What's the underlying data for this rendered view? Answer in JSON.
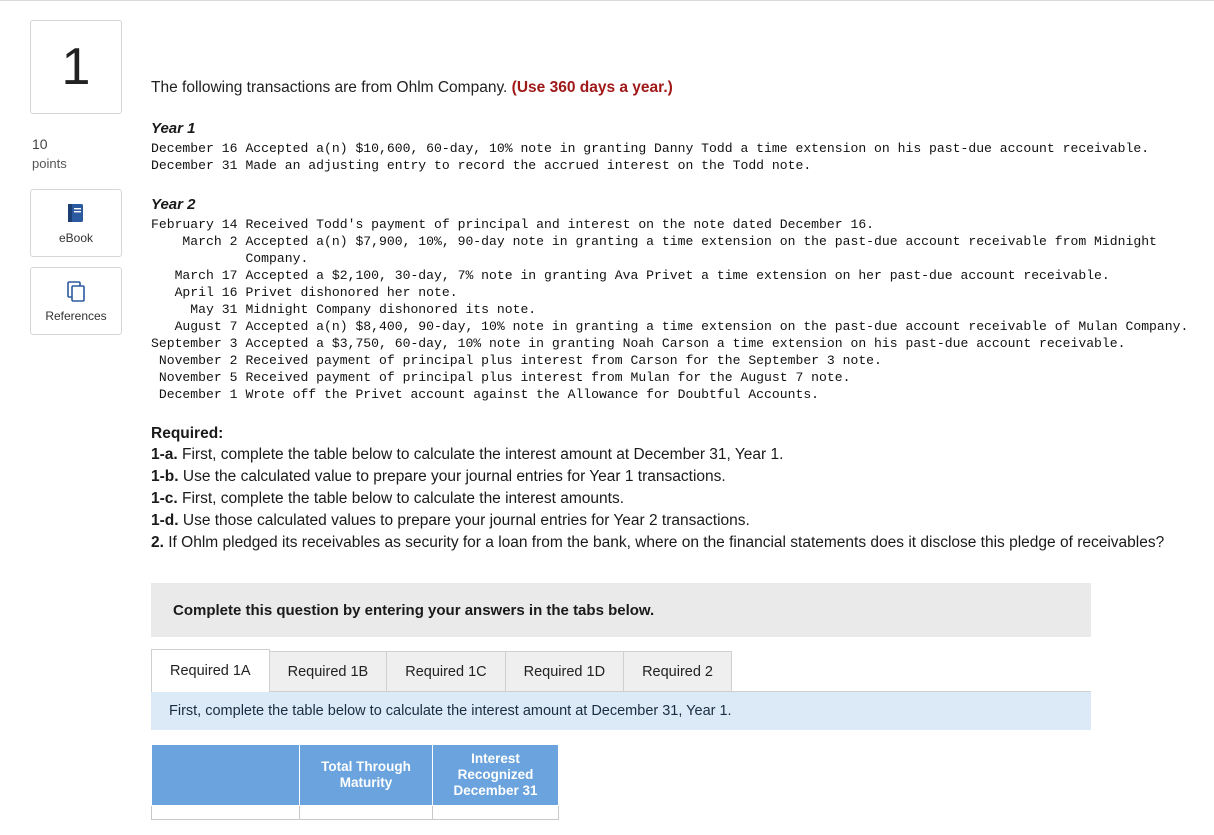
{
  "question": {
    "number": "1",
    "points_value": "10",
    "points_label": "points"
  },
  "rail_buttons": [
    {
      "name": "ebook",
      "label": "eBook",
      "icon": "book-icon"
    },
    {
      "name": "references",
      "label": "References",
      "icon": "copy-icon"
    }
  ],
  "intro": {
    "text": "The following transactions are from Ohlm Company. ",
    "emphasis": "(Use 360 days a year.)"
  },
  "year1": {
    "heading": "Year 1",
    "rows": [
      {
        "date": "December 16",
        "desc": "Accepted a(n) $10,600, 60-day, 10% note in granting Danny Todd a time extension on his past-due account receivable."
      },
      {
        "date": "December 31",
        "desc": "Made an adjusting entry to record the accrued interest on the Todd note."
      }
    ]
  },
  "year2": {
    "heading": "Year 2",
    "rows": [
      {
        "date": "February 14",
        "desc": "Received Todd's payment of principal and interest on the note dated December 16."
      },
      {
        "date": "March 2",
        "desc": "Accepted a(n) $7,900, 10%, 90-day note in granting a time extension on the past-due account receivable from Midnight Company."
      },
      {
        "date": "March 17",
        "desc": "Accepted a $2,100, 30-day, 7% note in granting Ava Privet a time extension on her past-due account receivable."
      },
      {
        "date": "April 16",
        "desc": "Privet dishonored her note."
      },
      {
        "date": "May 31",
        "desc": "Midnight Company dishonored its note."
      },
      {
        "date": "August 7",
        "desc": "Accepted a(n) $8,400, 90-day, 10% note in granting a time extension on the past-due account receivable of Mulan Company."
      },
      {
        "date": "September 3",
        "desc": "Accepted a $3,750, 60-day, 10% note in granting Noah Carson a time extension on his past-due account receivable."
      },
      {
        "date": "November 2",
        "desc": "Received payment of principal plus interest from Carson for the September 3 note."
      },
      {
        "date": "November 5",
        "desc": "Received payment of principal plus interest from Mulan for the August 7 note."
      },
      {
        "date": "December 1",
        "desc": "Wrote off the Privet account against the Allowance for Doubtful Accounts."
      }
    ]
  },
  "required": {
    "title": "Required:",
    "items": [
      {
        "label": "1-a.",
        "text": " First, complete the table below to calculate the interest amount at December 31, Year 1."
      },
      {
        "label": "1-b.",
        "text": " Use the calculated value to prepare your journal entries for Year 1 transactions."
      },
      {
        "label": "1-c.",
        "text": " First, complete the table below to calculate the interest amounts."
      },
      {
        "label": "1-d.",
        "text": " Use those calculated values to prepare your journal entries for Year 2 transactions."
      },
      {
        "label": "2.",
        "text": " If Ohlm pledged its receivables as security for a loan from the bank, where on the financial statements does it disclose this pledge of receivables?"
      }
    ]
  },
  "instruction_bar": {
    "text": "Complete this question by entering your answers in the tabs below."
  },
  "tabs": [
    {
      "label": "Required 1A",
      "active": true
    },
    {
      "label": "Required 1B",
      "active": false
    },
    {
      "label": "Required 1C",
      "active": false
    },
    {
      "label": "Required 1D",
      "active": false
    },
    {
      "label": "Required 2",
      "active": false
    }
  ],
  "tab_note": {
    "text": "First, complete the table below to calculate the interest amount at December 31, Year 1."
  },
  "answer_table": {
    "headers": [
      "",
      "Total Through Maturity",
      "Interest Recognized December 31"
    ]
  },
  "colors": {
    "accent_blue": "#6aa3dd",
    "note_blue": "#dceaf7",
    "emphasis_red": "#a11818",
    "grey_bar": "#eaeaea"
  }
}
